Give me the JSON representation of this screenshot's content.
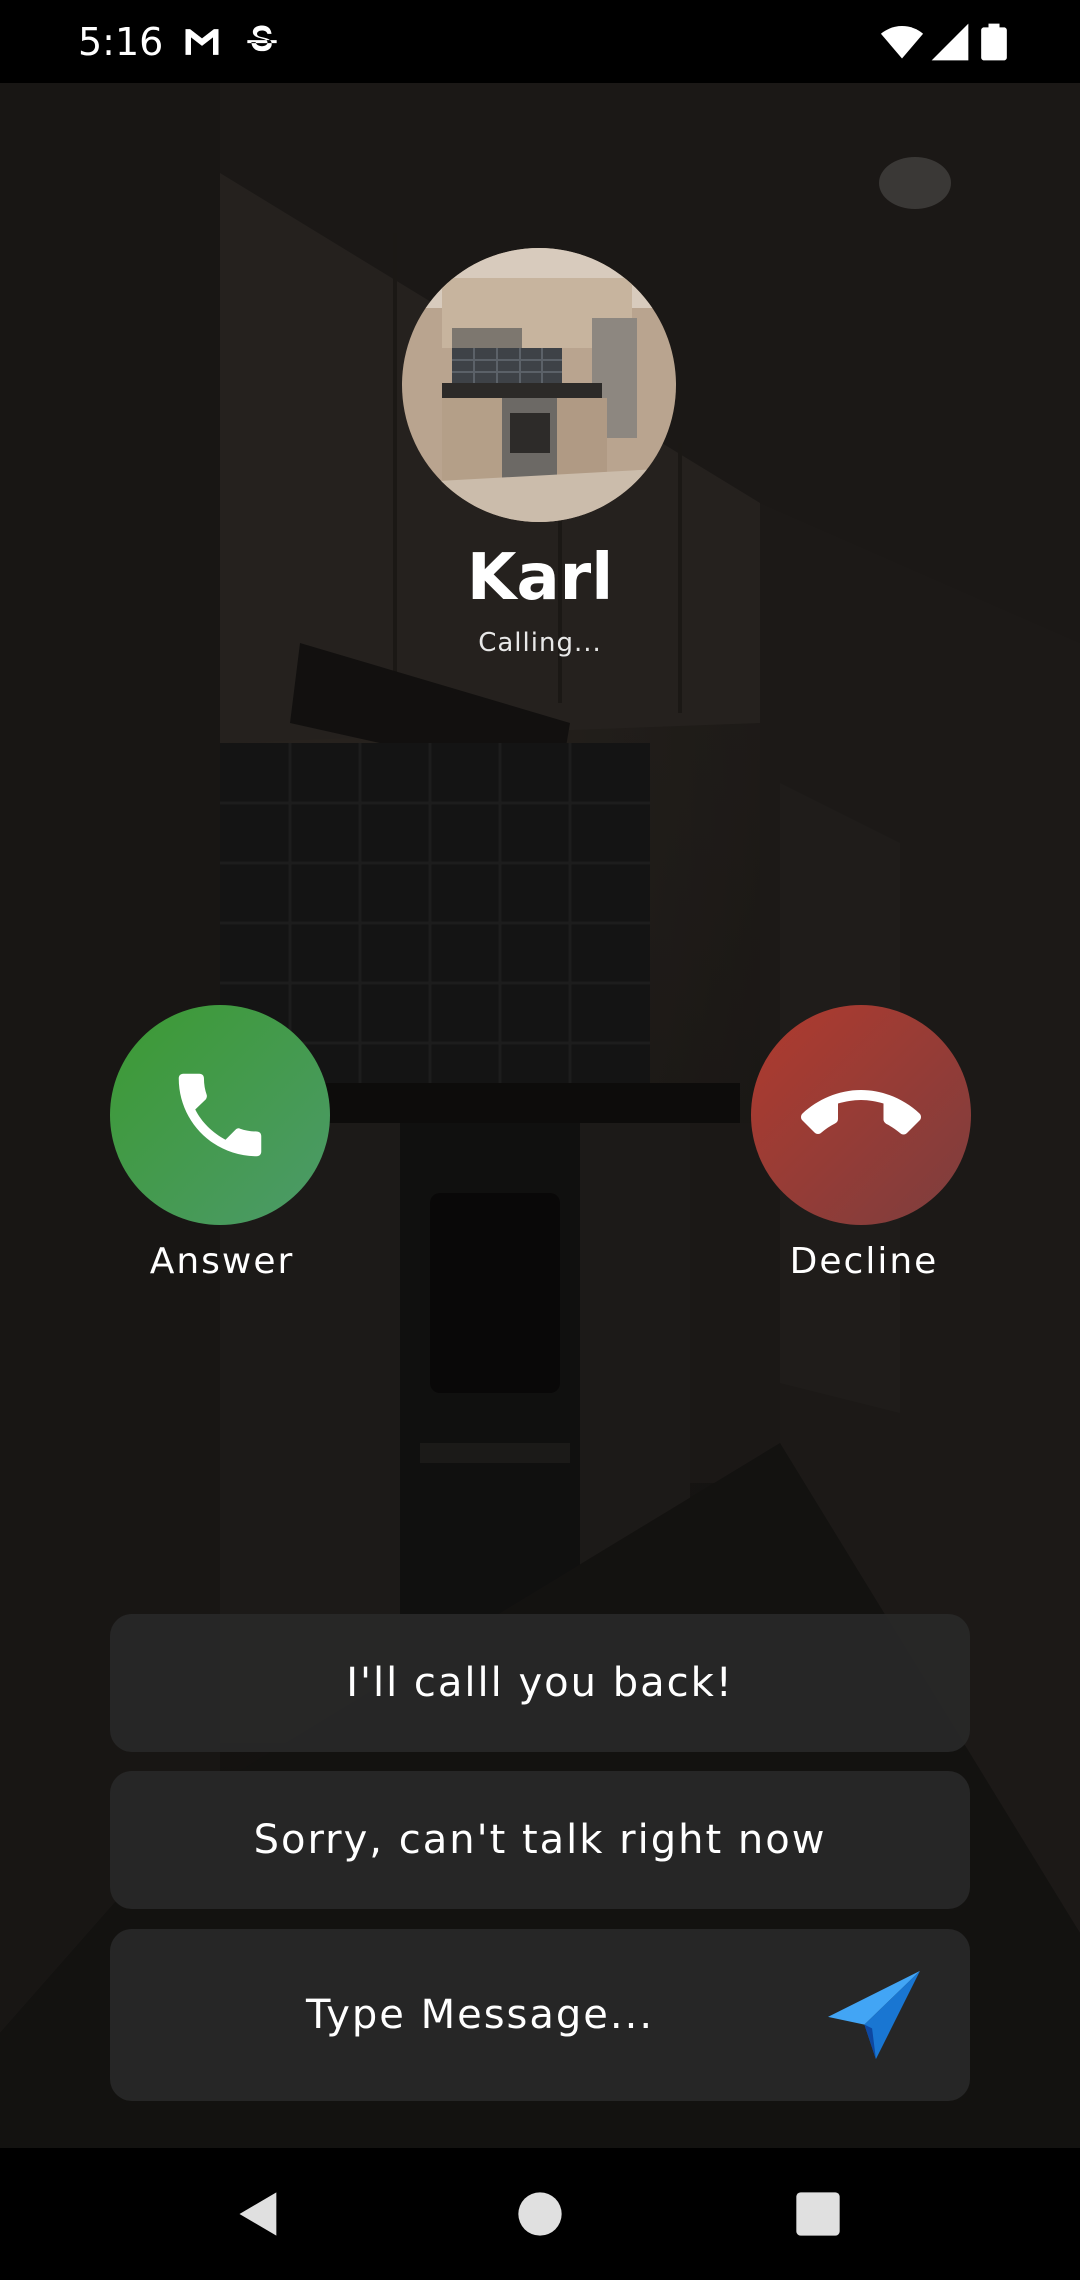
{
  "status_bar": {
    "time": "5:16",
    "icons": [
      "gmail-icon",
      "sim-icon",
      "wifi-icon",
      "signal-icon",
      "battery-icon"
    ]
  },
  "caller": {
    "name": "Karl",
    "status": "Calling..."
  },
  "actions": {
    "answer_label": "Answer",
    "decline_label": "Decline",
    "answer_color": "#3c9a32",
    "decline_color": "#b03a2e"
  },
  "quick_replies": [
    "I'll calll you back!",
    "Sorry, can't talk right now"
  ],
  "message_input": {
    "placeholder": "Type Message..."
  },
  "colors": {
    "send_icon": "#2196f3"
  }
}
